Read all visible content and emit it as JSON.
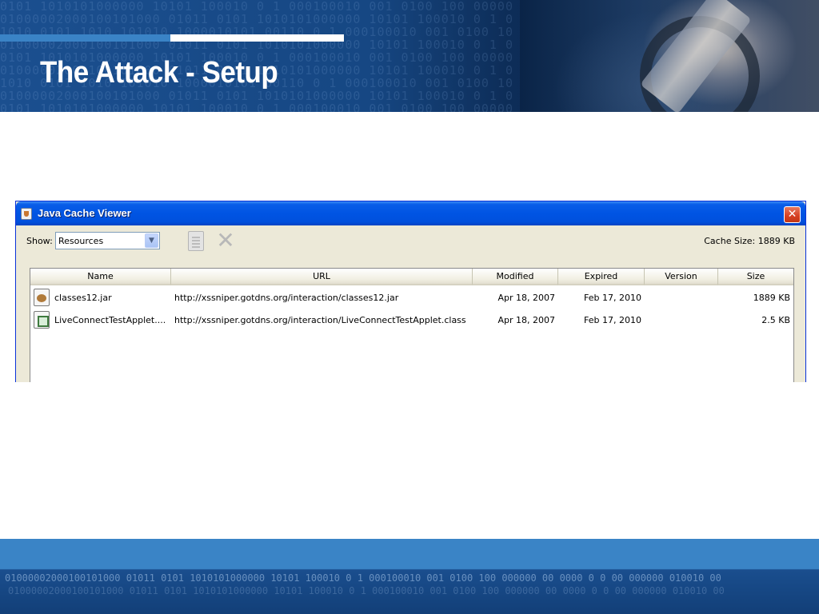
{
  "slide": {
    "title": "The Attack - Setup",
    "binary_text": "0101 1010101000000 10101 100010 0 1 000100010 001 0100 100 000000 00 0000\n01000002000100101000 01011 0101 1010101000000 10101 100010 0 1 000100\n1010 0101 1010 101010 1000010101 00110 0 1 000100010 001 0100 100 000\n01000002000100101000 01011 0101 1010101000000 10101 100010 0 1 000100\n0101 1010101000000 10101 100010 0 1 000100010 001 0100 100 000000 00 0000\n01000002000100101000 01011 0101 1010101000000 10101 100010 0 1 000100\n1010 0101 1010 101010 1000010101 00110 0 1 000100010 001 0100 100 000\n01000002000100101000 01011 0101 1010101000000 10101 100010 0 1 000100\n0101 1010101000000 10101 100010 0 1 000100010 001 0100 100 000000 00 0000",
    "footer_binary": "01000002000100101000 01011 0101 1010101000000 10101 100010 0 1 000100010 001 0100 100 000000 00 0000 0 0 00 000000 010010 00"
  },
  "window": {
    "title": "Java Cache Viewer",
    "close_label": "✕",
    "show_label": "Show:",
    "show_value": "Resources",
    "dropdown_arrow": "▼",
    "cache_size": "Cache Size:  1889 KB",
    "columns": [
      "Name",
      "URL",
      "Modified",
      "Expired",
      "Version",
      "Size"
    ],
    "rows": [
      {
        "icon": "jar-icon",
        "name": "classes12.jar",
        "url": "http://xssniper.gotdns.org/interaction/classes12.jar",
        "modified": "Apr 18, 2007",
        "expired": "Feb 17, 2010",
        "version": "",
        "size": "1889 KB"
      },
      {
        "icon": "class-icon",
        "name": "LiveConnectTestApplet....",
        "url": "http://xssniper.gotdns.org/interaction/LiveConnectTestApplet.class",
        "modified": "Apr 18, 2007",
        "expired": "Feb 17, 2010",
        "version": "",
        "size": "2.5 KB"
      }
    ]
  },
  "colors": {
    "slide_blue": "#164783",
    "accent_blue": "#3a83c6",
    "xp_title": "#0054e3",
    "xp_face": "#ece9d8"
  }
}
